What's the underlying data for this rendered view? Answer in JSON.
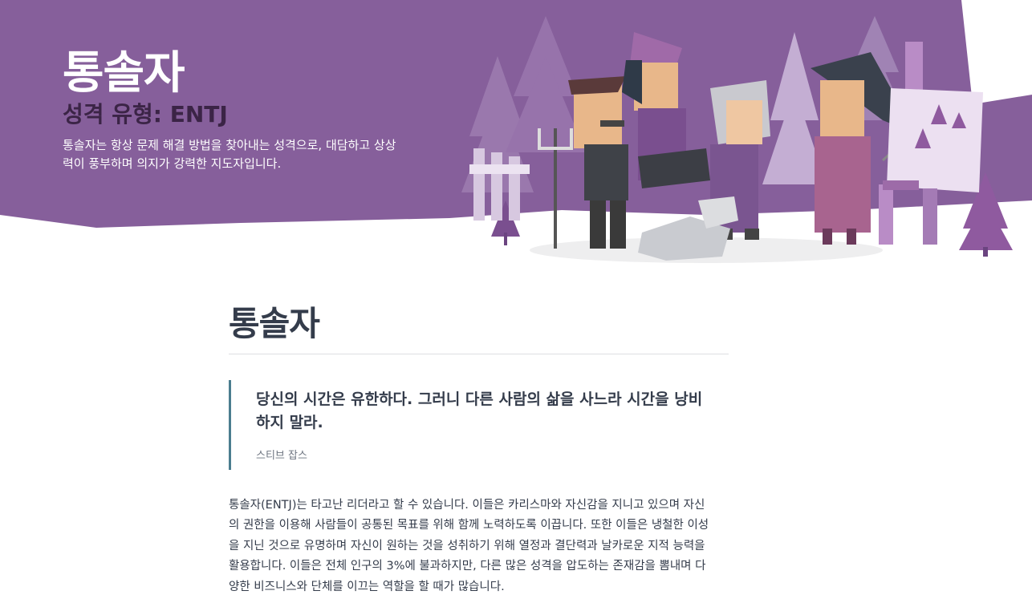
{
  "hero": {
    "title": "통솔자",
    "subtitle": "성격 유형: ENTJ",
    "description": "통솔자는 항상 문제 해결 방법을 찾아내는 성격으로, 대담하고 상상력이 풍부하며 의지가 강력한 지도자입니다.",
    "background_color": "#865f9b",
    "subtitle_color": "#3b2446"
  },
  "section": {
    "title": "통솔자"
  },
  "quote": {
    "text": "당신의 시간은 유한하다. 그러니 다른 사람의 삶을 사느라 시간을 낭비하지 말라.",
    "author": "스티브 잡스",
    "border_color": "#4b7d8f"
  },
  "body": {
    "paragraph": "통솔자(ENTJ)는 타고난 리더라고 할 수 있습니다. 이들은 카리스마와 자신감을 지니고 있으며 자신의 권한을 이용해 사람들이 공통된 목표를 위해 함께 노력하도록 이끕니다. 또한 이들은 냉철한 이성을 지닌 것으로 유명하며 자신이 원하는 것을 성취하기 위해 열정과 결단력과 날카로운 지적 능력을 활용합니다. 이들은 전체 인구의 3%에 불과하지만, 다른 많은 성격을 압도하는 존재감을 뽐내며 다양한 비즈니스와 단체를 이끄는 역할을 할 때가 많습니다."
  }
}
